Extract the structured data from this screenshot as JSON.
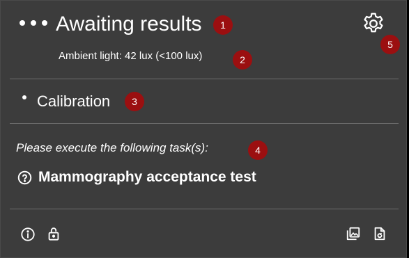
{
  "status": {
    "title": "Awaiting results",
    "ambient_light": "Ambient light: 42 lux (<100 lux)"
  },
  "calibration": {
    "title": "Calibration"
  },
  "tasks": {
    "instruction": "Please execute the following task(s):",
    "items": [
      {
        "name": "Mammography acceptance test",
        "icon": "question-circle-icon"
      }
    ]
  },
  "markers": [
    "1",
    "2",
    "3",
    "4",
    "5"
  ],
  "toolbar": {
    "settings_icon": "gear-icon",
    "footer_icons": [
      "info-icon",
      "unlock-icon",
      "image-report-icon",
      "document-refresh-icon"
    ]
  },
  "colors": {
    "panel_background": "#3c3c3c",
    "divider": "#6e6e6e",
    "marker": "#9b0f10",
    "text": "#ffffff"
  }
}
